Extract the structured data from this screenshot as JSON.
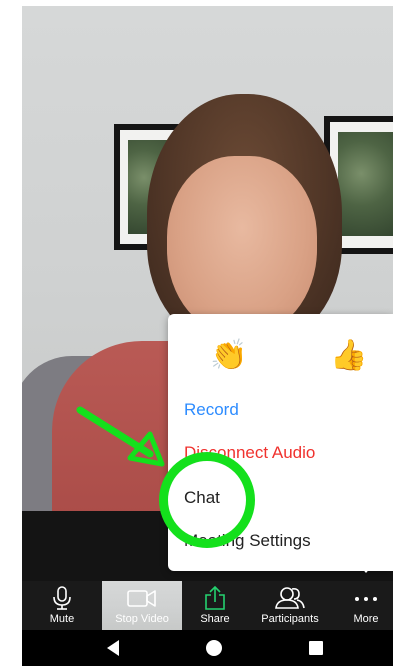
{
  "reactions": {
    "clap": "👏",
    "thumbs_up": "👍"
  },
  "menu": {
    "record": "Record",
    "disconnect_audio": "Disconnect Audio",
    "chat": "Chat",
    "meeting_settings": "Meeting Settings"
  },
  "toolbar": {
    "mute": "Mute",
    "stop_video": "Stop Video",
    "share": "Share",
    "participants": "Participants",
    "more": "More"
  },
  "colors": {
    "record_text": "#2d8cff",
    "disconnect_text": "#f0322e",
    "share_icon": "#24d16f",
    "highlight": "#14e01c",
    "toolbar_bg": "#1a1a1a"
  }
}
